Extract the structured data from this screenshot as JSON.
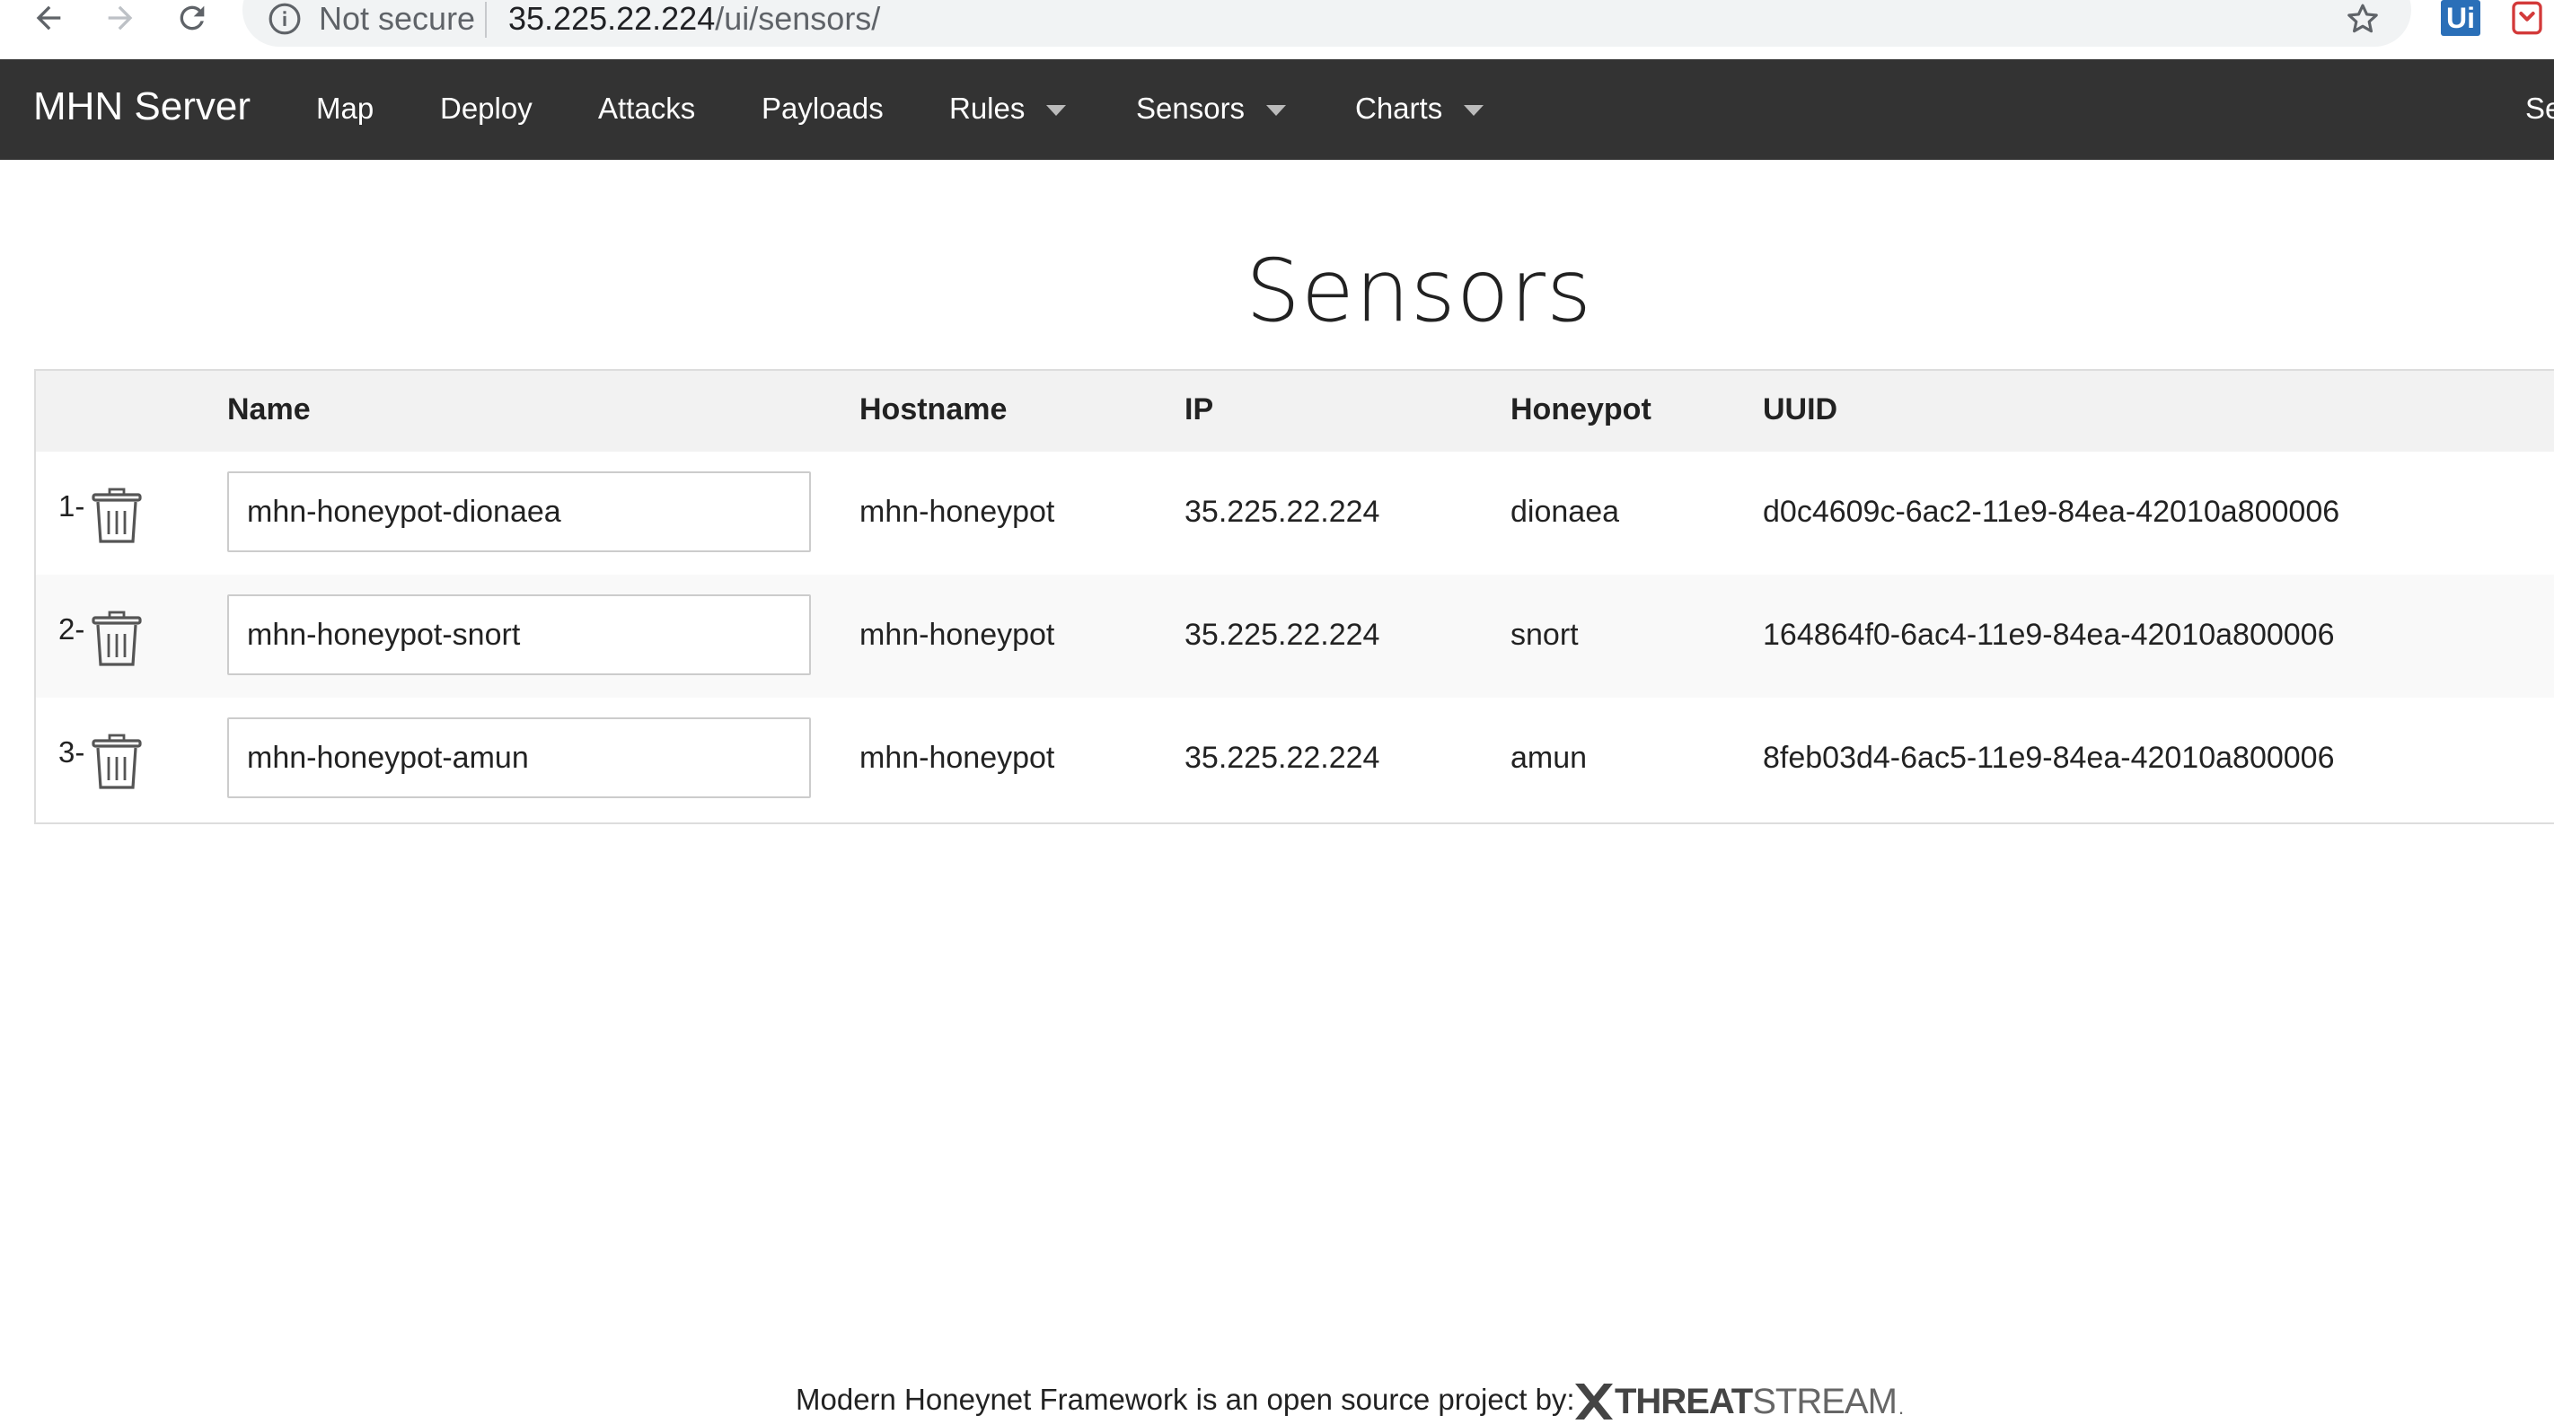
{
  "browser": {
    "security_label": "Not secure",
    "url_host": "35.225.22.224",
    "url_path": "/ui/sensors/",
    "extension_ui_label": "Ui"
  },
  "navbar": {
    "brand": "MHN Server",
    "items": [
      {
        "label": "Map",
        "dropdown": false
      },
      {
        "label": "Deploy",
        "dropdown": false
      },
      {
        "label": "Attacks",
        "dropdown": false
      },
      {
        "label": "Payloads",
        "dropdown": false
      },
      {
        "label": "Rules",
        "dropdown": true
      },
      {
        "label": "Sensors",
        "dropdown": true
      },
      {
        "label": "Charts",
        "dropdown": true
      }
    ],
    "right_cut_label": "Se"
  },
  "page": {
    "title": "Sensors"
  },
  "table": {
    "headers": [
      "Name",
      "Hostname",
      "IP",
      "Honeypot",
      "UUID"
    ],
    "rows": [
      {
        "index": "1-",
        "name": "mhn-honeypot-dionaea",
        "hostname": "mhn-honeypot",
        "ip": "35.225.22.224",
        "honeypot": "dionaea",
        "uuid": "d0c4609c-6ac2-11e9-84ea-42010a800006"
      },
      {
        "index": "2-",
        "name": "mhn-honeypot-snort",
        "hostname": "mhn-honeypot",
        "ip": "35.225.22.224",
        "honeypot": "snort",
        "uuid": "164864f0-6ac4-11e9-84ea-42010a800006"
      },
      {
        "index": "3-",
        "name": "mhn-honeypot-amun",
        "hostname": "mhn-honeypot",
        "ip": "35.225.22.224",
        "honeypot": "amun",
        "uuid": "8feb03d4-6ac5-11e9-84ea-42010a800006"
      }
    ]
  },
  "footer": {
    "text": "Modern Honeynet Framework is an open source project by:",
    "logo_threat": "THREAT",
    "logo_stream": "STREAM",
    "logo_dot": "."
  },
  "colors": {
    "navbar_bg": "#333333",
    "header_row_bg": "#f2f2f2",
    "alt_row_bg": "#f9f9f9"
  }
}
